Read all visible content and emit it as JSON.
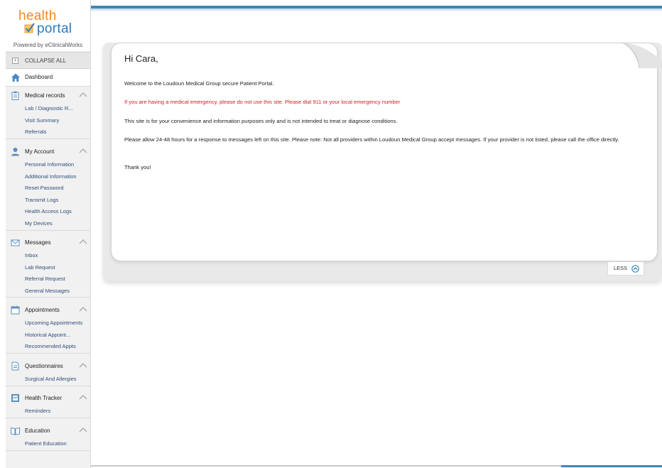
{
  "brand": {
    "word1": "health",
    "word2": "portal",
    "powered_by": "Powered by eClinicalWorks",
    "colors": {
      "orange": "#f08a1c",
      "blue": "#2f79b5",
      "accent": "#3a89b8",
      "alert": "#cc2222"
    }
  },
  "sidebar": {
    "collapse_all": "COLLAPSE ALL",
    "dashboard": {
      "label": "Dashboard",
      "icon": "home-icon"
    },
    "sections": [
      {
        "title": "Medical records",
        "icon": "clipboard-icon",
        "items": [
          "Lab / Diagnostic R...",
          "Visit Summary",
          "Referrals"
        ]
      },
      {
        "title": "My Account",
        "icon": "user-icon",
        "items": [
          "Personal Information",
          "Additional Information",
          "Reset Password",
          "Transmit Logs",
          "Health Access Logs",
          "My Devices"
        ]
      },
      {
        "title": "Messages",
        "icon": "envelope-icon",
        "items": [
          "Inbox",
          "Lab Request",
          "Referral Request",
          "General Messages"
        ]
      },
      {
        "title": "Appointments",
        "icon": "calendar-icon",
        "items": [
          "Upcoming Appointments",
          "Historical Appoint...",
          "Recommended Appts"
        ]
      },
      {
        "title": "Questionnaires",
        "icon": "document-icon",
        "items": [
          "Surgical And Allergies"
        ]
      },
      {
        "title": "Health Tracker",
        "icon": "tracker-icon",
        "items": [
          "Reminders"
        ]
      },
      {
        "title": "Education",
        "icon": "book-icon",
        "items": [
          "Patient Education"
        ]
      }
    ]
  },
  "message": {
    "greeting": "Hi Cara,",
    "welcome": "Welcome to the Loudoun Medical Group secure Patient Portal.",
    "emergency": "If you are having a medical emergency, please do not use this site.  Please dial 911 or your local emergency number",
    "disclaimer": "This site is for your convenience and information purposes only and is not intended to treat or diagnose conditions.",
    "response_note": "Please allow 24-48 hours for a response to messages left on this site.  Please note: Not all providers within Loudoun Medical Group accept messages.  If your provider is not listed, please call the office directly.",
    "thanks": "Thank you!",
    "less_label": "LESS",
    "less_icon": "chevron-up-circle-icon"
  }
}
